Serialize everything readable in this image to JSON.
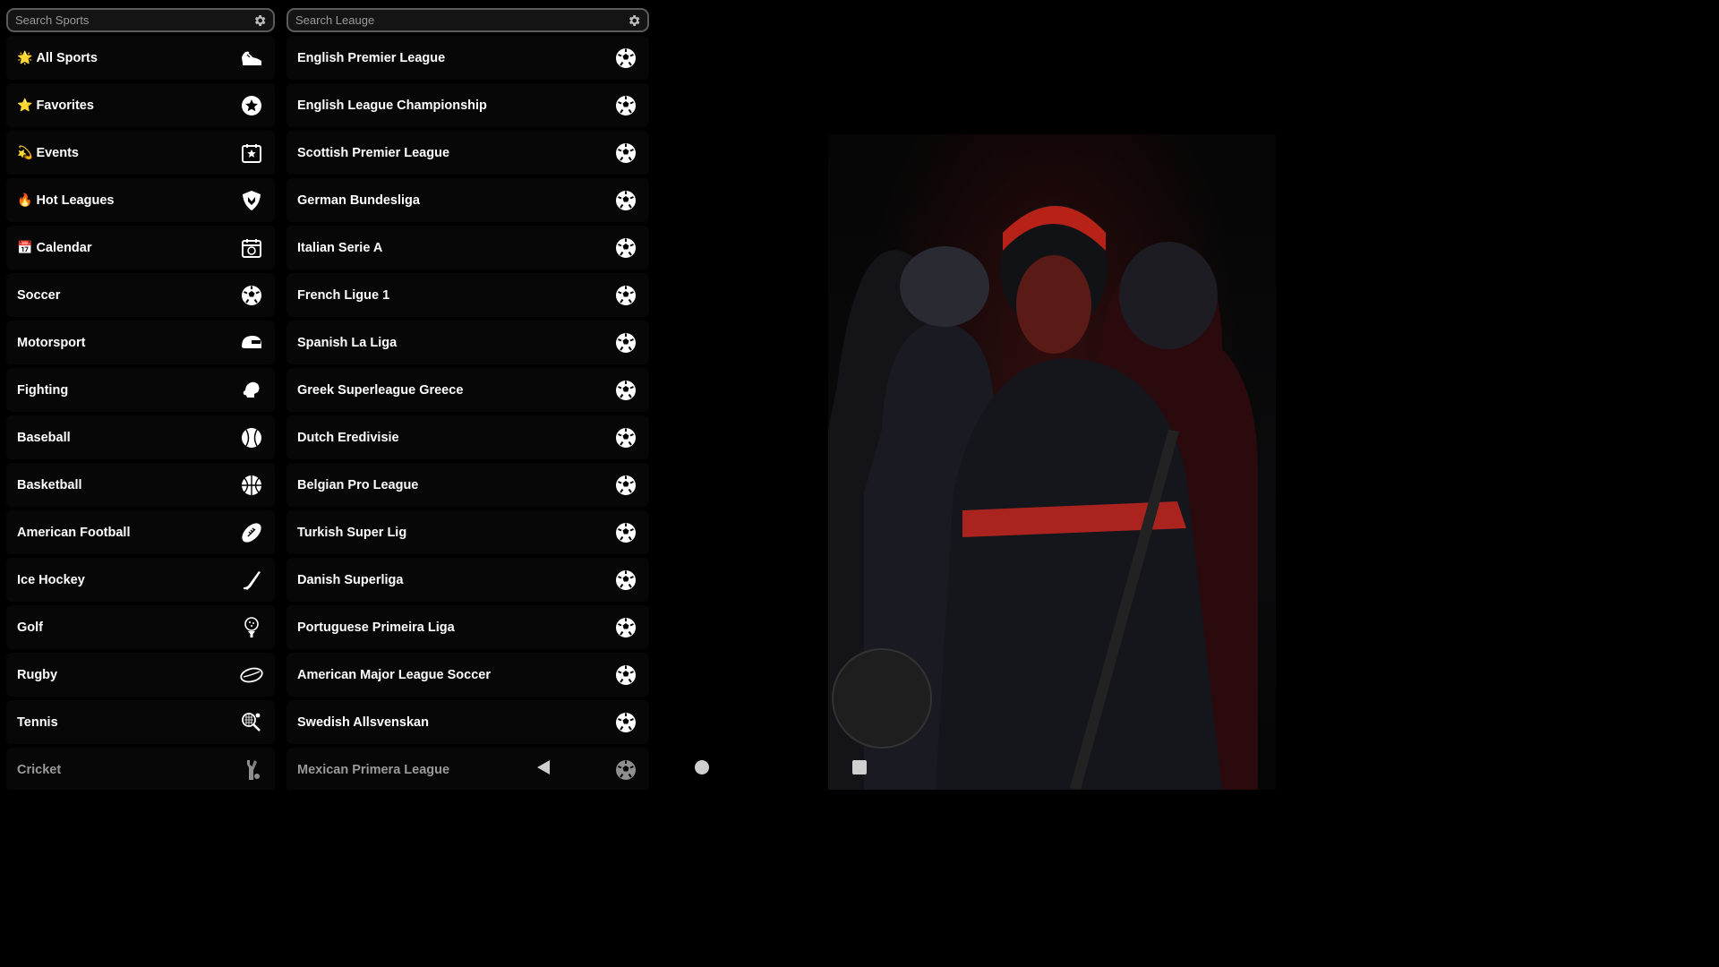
{
  "search_sports": {
    "placeholder": "Search Sports",
    "icon": "gear-icon"
  },
  "search_league": {
    "placeholder": "Search Leauge",
    "icon": "gear-icon"
  },
  "sports": [
    {
      "emoji": "🌟",
      "label": "All Sports",
      "icon": "sneaker-icon"
    },
    {
      "emoji": "⭐",
      "label": "Favorites",
      "icon": "star-badge-icon"
    },
    {
      "emoji": "💫",
      "label": "Events",
      "icon": "calendar-star-icon"
    },
    {
      "emoji": "🔥",
      "label": "Hot Leagues",
      "icon": "shield-icon"
    },
    {
      "emoji": "📅",
      "label": "Calendar",
      "icon": "calendar-icon"
    },
    {
      "emoji": "",
      "label": "Soccer",
      "icon": "soccer-ball-icon"
    },
    {
      "emoji": "",
      "label": "Motorsport",
      "icon": "helmet-icon"
    },
    {
      "emoji": "",
      "label": "Fighting",
      "icon": "boxing-glove-icon"
    },
    {
      "emoji": "",
      "label": "Baseball",
      "icon": "baseball-icon"
    },
    {
      "emoji": "",
      "label": "Basketball",
      "icon": "basketball-icon"
    },
    {
      "emoji": "",
      "label": "American Football",
      "icon": "football-icon"
    },
    {
      "emoji": "",
      "label": "Ice Hockey",
      "icon": "hockey-stick-icon"
    },
    {
      "emoji": "",
      "label": "Golf",
      "icon": "golf-ball-tee-icon"
    },
    {
      "emoji": "",
      "label": "Rugby",
      "icon": "rugby-ball-icon"
    },
    {
      "emoji": "",
      "label": "Tennis",
      "icon": "tennis-racket-icon"
    },
    {
      "emoji": "",
      "label": "Cricket",
      "icon": "cricket-bat-icon"
    }
  ],
  "leagues": [
    {
      "label": "English Premier League"
    },
    {
      "label": "English League Championship"
    },
    {
      "label": "Scottish Premier League"
    },
    {
      "label": "German Bundesliga"
    },
    {
      "label": "Italian Serie A"
    },
    {
      "label": "French Ligue 1"
    },
    {
      "label": "Spanish La Liga"
    },
    {
      "label": "Greek Superleague Greece"
    },
    {
      "label": "Dutch Eredivisie"
    },
    {
      "label": "Belgian Pro League"
    },
    {
      "label": "Turkish Super Lig"
    },
    {
      "label": "Danish Superliga"
    },
    {
      "label": "Portuguese Primeira Liga"
    },
    {
      "label": "American Major League Soccer"
    },
    {
      "label": "Swedish Allsvenskan"
    },
    {
      "label": "Mexican Primera League"
    }
  ],
  "nav": {
    "back": "back-icon",
    "home": "home-icon",
    "recents": "recents-icon"
  },
  "colors": {
    "background": "#000000",
    "row": "#070707",
    "accent": "#d11f1f"
  }
}
